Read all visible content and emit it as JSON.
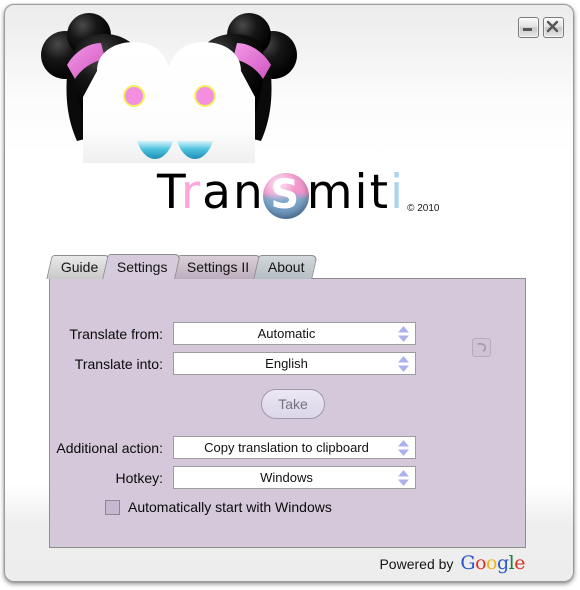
{
  "window": {
    "controls": [
      {
        "name": "minimize-button",
        "label": "minimize-icon"
      },
      {
        "name": "close-button",
        "label": "close-icon"
      }
    ]
  },
  "branding": {
    "logo_parts": [
      {
        "text": "T",
        "color": "#000000"
      },
      {
        "text": "r",
        "color": "#ffa6dd"
      },
      {
        "text": "an",
        "color": "#000000"
      },
      {
        "text": "S",
        "color": "#ffffff",
        "badge": true
      },
      {
        "text": "mit",
        "color": "#000000"
      },
      {
        "text": "i",
        "color": "#a8d4f0"
      }
    ],
    "logo_full": "TranSmiti",
    "copyright": "© 2010",
    "mascot_alt": "twin-bun-girl-mascot"
  },
  "tabs": [
    {
      "label": "Guide",
      "active": false
    },
    {
      "label": "Settings",
      "active": true
    },
    {
      "label": "Settings II",
      "active": false
    },
    {
      "label": "About",
      "active": false
    }
  ],
  "settings": {
    "translate_from": {
      "label": "Translate from:",
      "value": "Automatic"
    },
    "translate_into": {
      "label": "Translate into:",
      "value": "English"
    },
    "swap_button": "swap-languages-icon",
    "take_button": "Take",
    "additional_action": {
      "label": "Additional action:",
      "value": "Copy translation to clipboard"
    },
    "hotkey": {
      "label": "Hotkey:",
      "value": "Windows"
    },
    "autostart": {
      "label": "Automatically start with Windows",
      "checked": false
    }
  },
  "footer": {
    "powered_by": "Powered by",
    "google": [
      {
        "letter": "G",
        "color": "#2a56c6"
      },
      {
        "letter": "o",
        "color": "#d93025"
      },
      {
        "letter": "o",
        "color": "#f2b50e"
      },
      {
        "letter": "g",
        "color": "#2a56c6"
      },
      {
        "letter": "l",
        "color": "#188038"
      },
      {
        "letter": "e",
        "color": "#d93025"
      }
    ]
  },
  "colors": {
    "panel_bg": "#d4c8da",
    "tab_active_bg": "#d6cadd",
    "window_bg_top": "#ececec",
    "accent_pink": "#ffa6dd",
    "accent_blue": "#a8d4f0",
    "spinner_arrow": "#aeb2ec"
  }
}
